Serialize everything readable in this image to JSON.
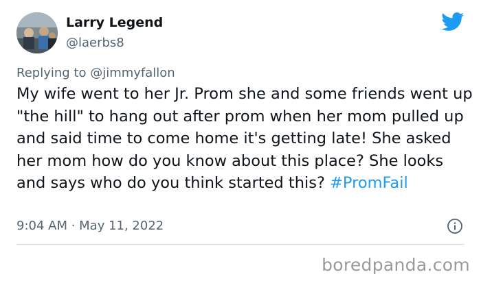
{
  "user": {
    "display_name": "Larry Legend",
    "handle": "@laerbs8"
  },
  "reply": {
    "prefix": "Replying to ",
    "mention": "@jimmyfallon"
  },
  "tweet": {
    "text": "My wife went to her Jr. Prom she and some friends went up \"the hill\" to hang out after prom when her mom pulled up and said time to come home it's getting late! She asked her mom how do you know about this place? She looks and says who do you think started this? ",
    "hashtag": "#PromFail"
  },
  "meta": {
    "timestamp": "9:04 AM · May 11, 2022"
  },
  "watermark": "boredpanda.com",
  "colors": {
    "link": "#1d9bf0",
    "secondary_text": "#536471",
    "primary_text": "#0f1419",
    "divider": "#cfd9de"
  },
  "icons": [
    "twitter-bird-icon",
    "info-icon"
  ]
}
